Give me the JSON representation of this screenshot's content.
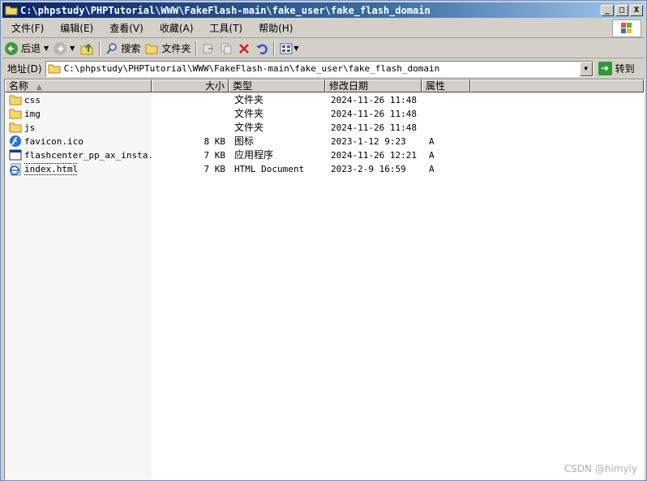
{
  "window": {
    "title": "C:\\phpstudy\\PHPTutorial\\WWW\\FakeFlash-main\\fake_user\\fake_flash_domain",
    "buttons": [
      "_",
      "□",
      "X"
    ]
  },
  "menu": [
    "文件(F)",
    "编辑(E)",
    "查看(V)",
    "收藏(A)",
    "工具(T)",
    "帮助(H)"
  ],
  "toolbar": {
    "back": "后退",
    "search": "搜索",
    "folders": "文件夹"
  },
  "address": {
    "label": "地址(D)",
    "value": "C:\\phpstudy\\PHPTutorial\\WWW\\FakeFlash-main\\fake_user\\fake_flash_domain",
    "go": "转到"
  },
  "columns": {
    "name": "名称",
    "size": "大小",
    "type": "类型",
    "date": "修改日期",
    "attr": "属性"
  },
  "files": [
    {
      "name": "css",
      "size": "",
      "type": "文件夹",
      "date": "2024-11-26 11:48",
      "attr": "",
      "icon": "folder-icon"
    },
    {
      "name": "img",
      "size": "",
      "type": "文件夹",
      "date": "2024-11-26 11:48",
      "attr": "",
      "icon": "folder-icon"
    },
    {
      "name": "js",
      "size": "",
      "type": "文件夹",
      "date": "2024-11-26 11:48",
      "attr": "",
      "icon": "folder-icon"
    },
    {
      "name": "favicon.ico",
      "size": "8 KB",
      "type": "图标",
      "date": "2023-1-12 9:23",
      "attr": "A",
      "icon": "flash-icon"
    },
    {
      "name": "flashcenter_pp_ax_insta...",
      "size": "7 KB",
      "type": "应用程序",
      "date": "2024-11-26 12:21",
      "attr": "A",
      "icon": "application-icon"
    },
    {
      "name": "index.html",
      "size": "7 KB",
      "type": "HTML Document",
      "date": "2023-2-9 16:59",
      "attr": "A",
      "icon": "ie-document-icon"
    }
  ],
  "watermark": "CSDN @himyly"
}
